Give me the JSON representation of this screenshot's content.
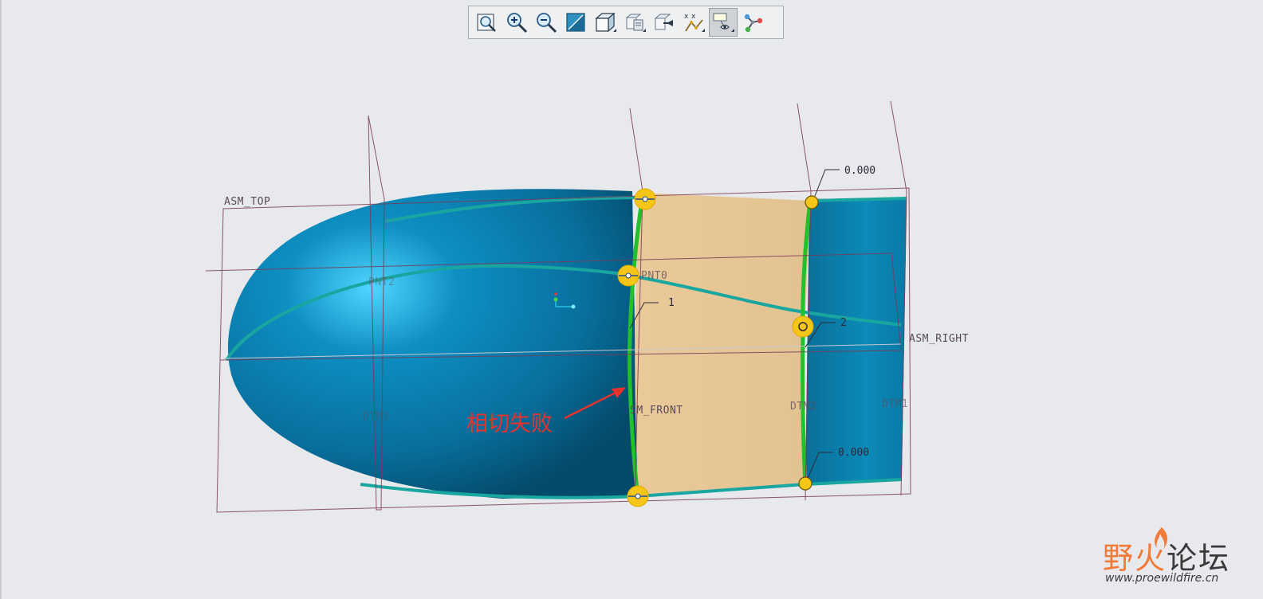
{
  "toolbar": {
    "buttons": [
      {
        "name": "refit",
        "icon": "zoom-fit-icon"
      },
      {
        "name": "zoom-in",
        "icon": "zoom-in-icon"
      },
      {
        "name": "zoom-out",
        "icon": "zoom-out-icon"
      },
      {
        "name": "repaint",
        "icon": "repaint-icon"
      },
      {
        "name": "display-style",
        "icon": "cube-shaded-icon"
      },
      {
        "name": "saved-orientations",
        "icon": "saved-views-icon"
      },
      {
        "name": "view-manager",
        "icon": "view-manager-icon"
      },
      {
        "name": "datum-display",
        "icon": "datum-display-icon"
      },
      {
        "name": "annotation-display",
        "icon": "annotation-display-icon",
        "active": true
      },
      {
        "name": "connection-display",
        "icon": "connection-icon"
      }
    ]
  },
  "model": {
    "datums": {
      "asm_top": "ASM_TOP",
      "asm_right": "ASM_RIGHT",
      "asm_front": "SM_FRONT",
      "pnt0": "PNT0",
      "pnt2": "PNT2",
      "dtm3": "DTM3",
      "dtm_mid": "DTM2",
      "dtm1": "DTM1"
    },
    "dimensions": {
      "top_value": "0.000",
      "bottom_value": "0.000",
      "left_index": "1",
      "right_index": "2"
    },
    "colors": {
      "surface": "#0a7aa8",
      "boundary_fill": "#e8c690",
      "boundary_edge": "#22c02a",
      "handle": "#f5c518",
      "curve": "#1aa6a0",
      "datum_lines": "#7a3a55"
    }
  },
  "annotation": {
    "text": "相切失败",
    "color": "#e8322e"
  },
  "watermark": {
    "brand_part1": "野火",
    "brand_part2": "论坛",
    "url": "www.proewildfire.cn"
  }
}
